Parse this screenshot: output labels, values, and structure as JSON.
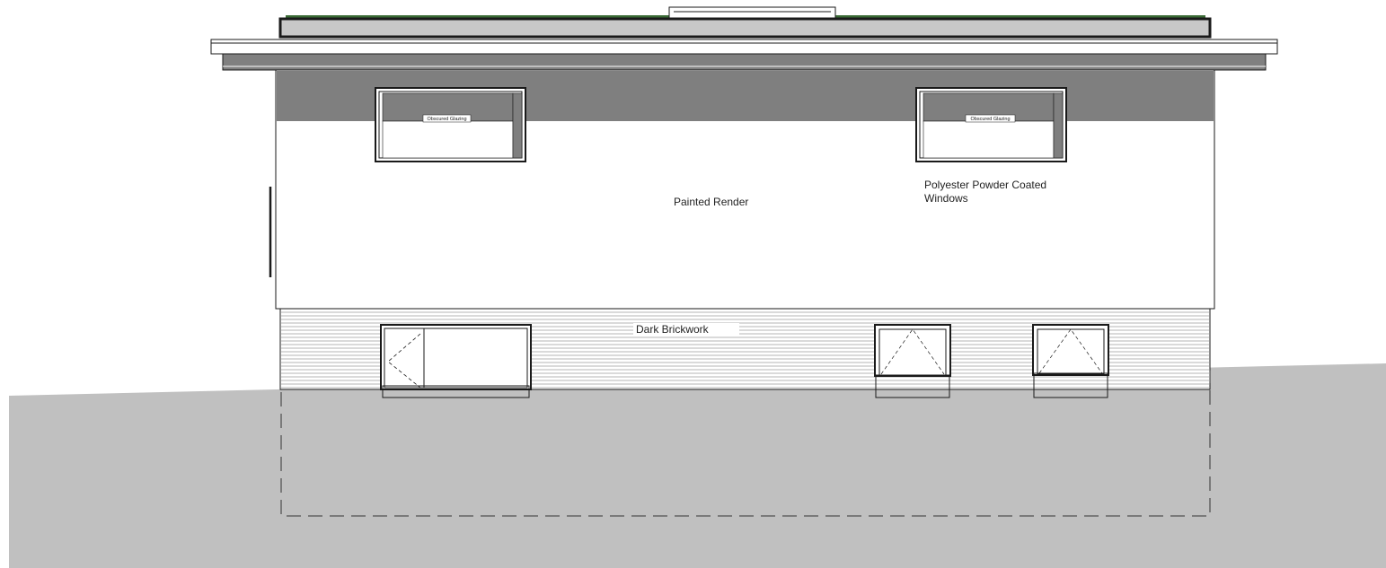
{
  "drawing": {
    "labels": {
      "painted_render": "Painted Render",
      "windows_line1": "Polyester Powder Coated",
      "windows_line2": "Windows",
      "dark_brickwork": "Dark Brickwork",
      "obscured_glazing_left": "Obscured Glazing",
      "obscured_glazing_right": "Obscured Glazing"
    },
    "colors": {
      "ground": "#c0c0c0",
      "fascia_band": "#7f7f7f",
      "roof_parapet": "#c8c8c8",
      "roof_green": "#3a6b35",
      "line": "#1a1a1a",
      "render": "#ffffff"
    }
  }
}
